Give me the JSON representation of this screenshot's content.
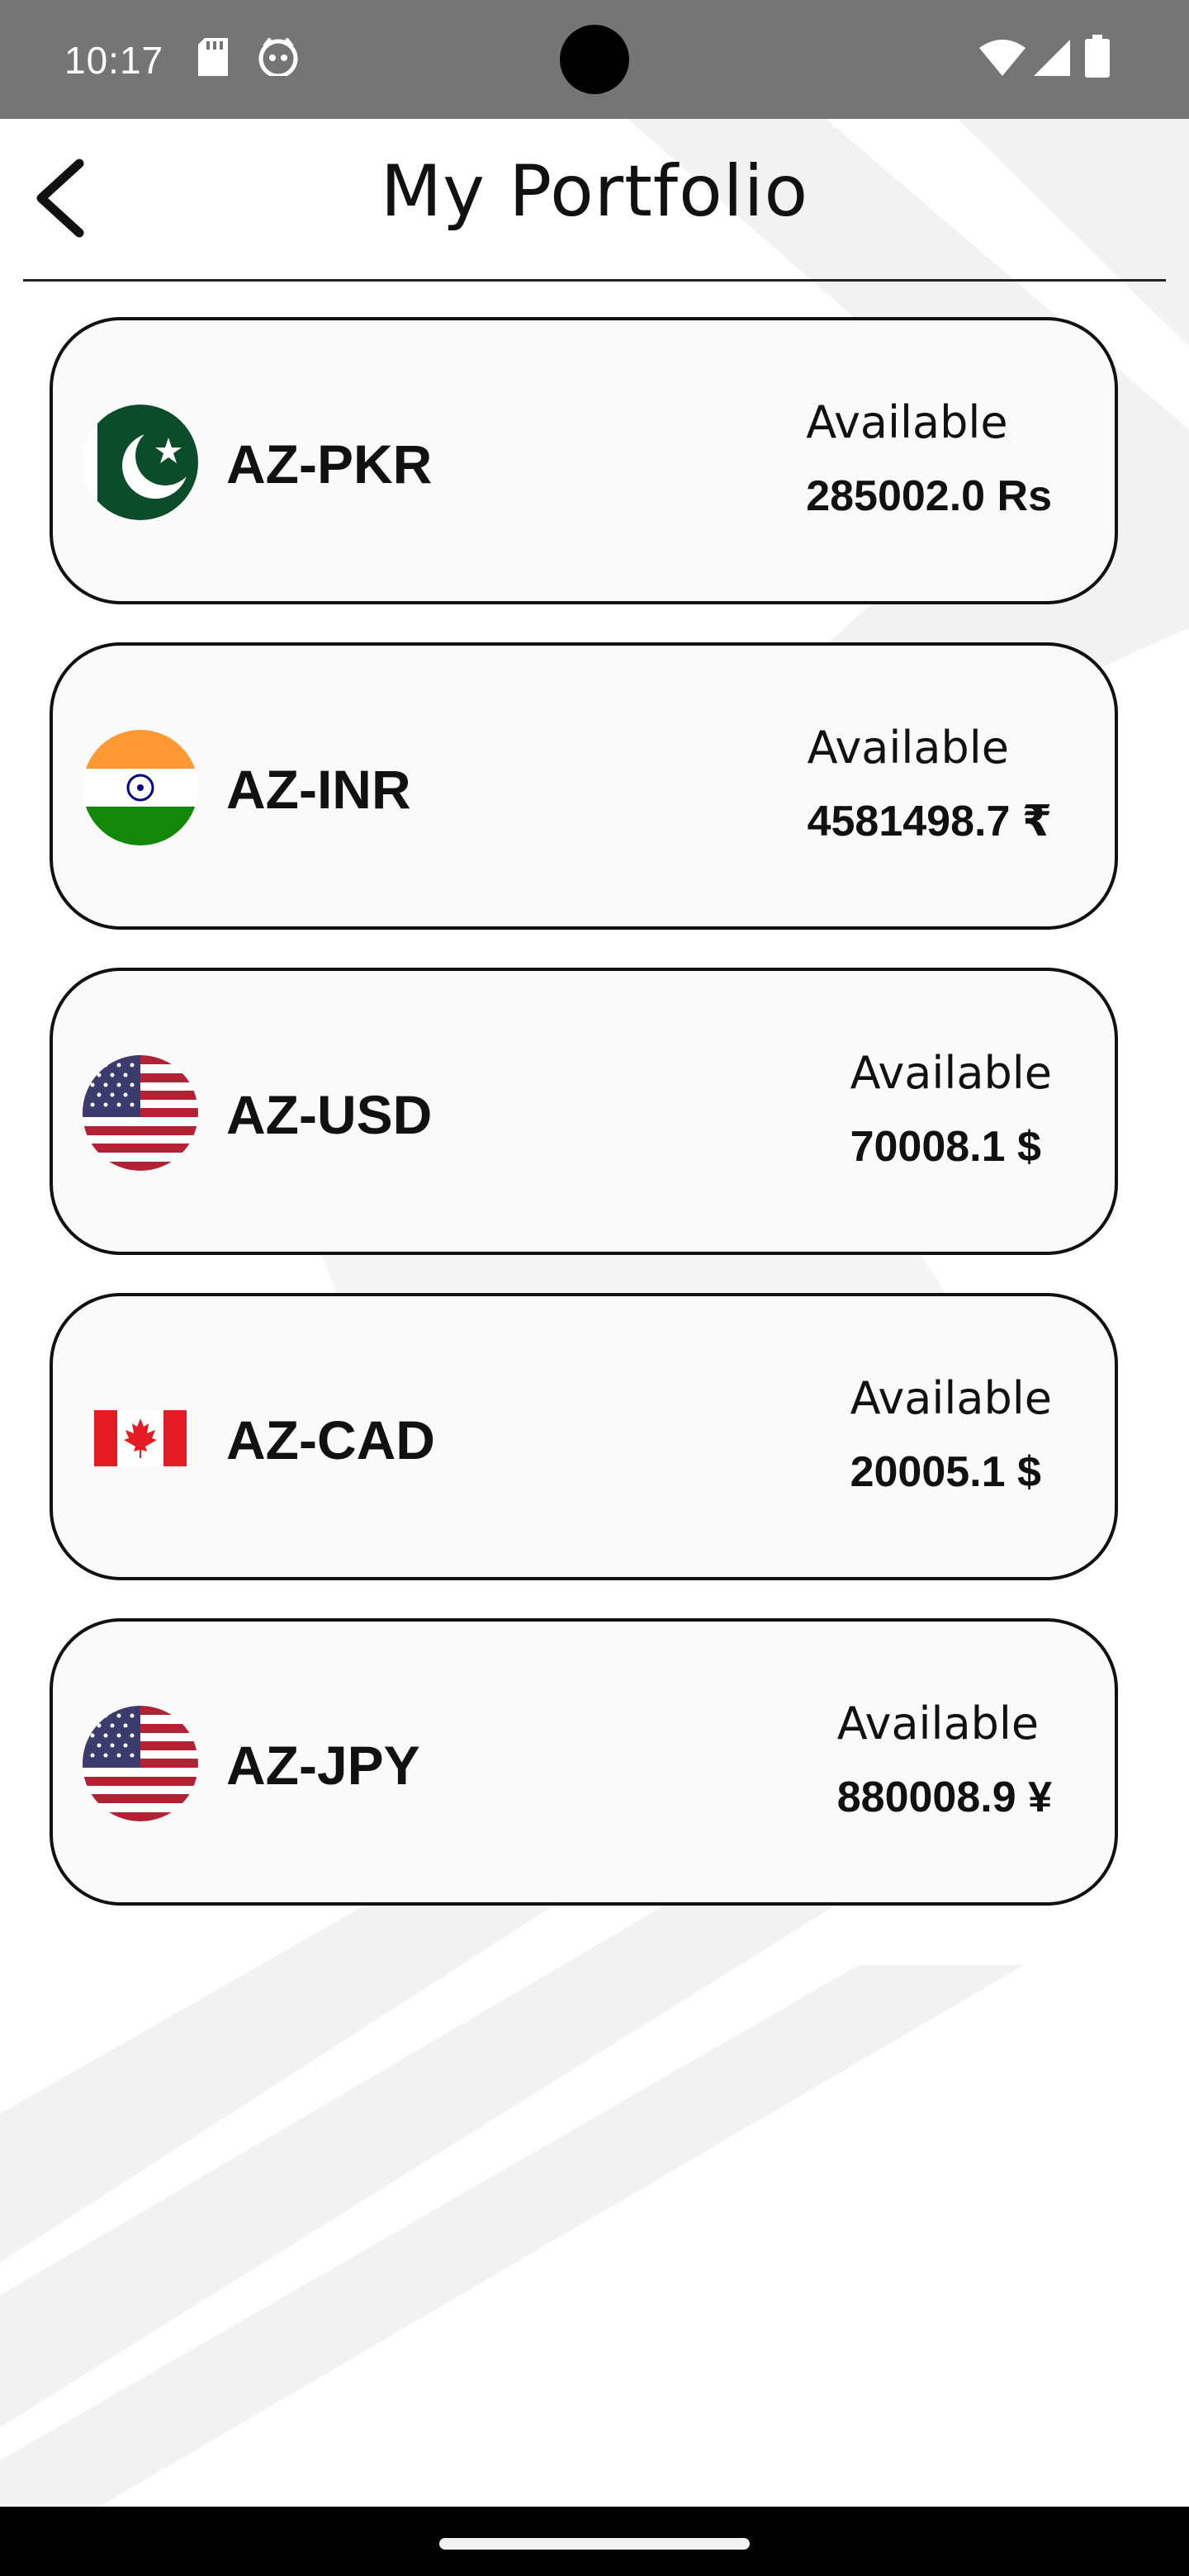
{
  "status_bar": {
    "time": "10:17",
    "icons": [
      "sd-card-icon",
      "cat-face-icon",
      "wifi-icon",
      "signal-icon",
      "battery-icon"
    ]
  },
  "header": {
    "title": "My Portfolio",
    "back_icon": "chevron-left-icon"
  },
  "wallets": [
    {
      "name": "AZ-PKR",
      "flag": "pakistan-flag-icon",
      "label": "Available",
      "balance": "285002.0 Rs"
    },
    {
      "name": "AZ-INR",
      "flag": "india-flag-icon",
      "label": "Available",
      "balance": "4581498.7 ₹"
    },
    {
      "name": "AZ-USD",
      "flag": "usa-flag-icon",
      "label": "Available",
      "balance": "70008.1 $"
    },
    {
      "name": "AZ-CAD",
      "flag": "canada-flag-icon",
      "label": "Available",
      "balance": "20005.1 $"
    },
    {
      "name": "AZ-JPY",
      "flag": "usa-flag-icon",
      "label": "Available",
      "balance": "880008.9 ¥"
    }
  ],
  "colors": {
    "status_bar": "#757575",
    "card_border": "#111111",
    "card_background": "#fafafa",
    "text": "#111111"
  }
}
